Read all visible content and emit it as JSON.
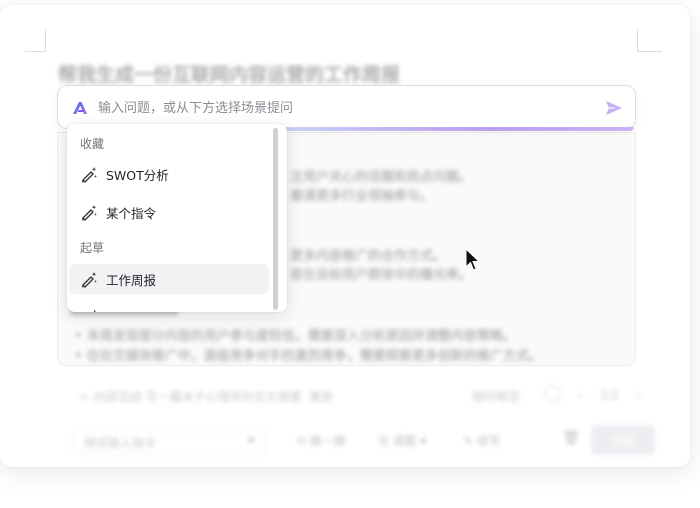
{
  "background_doc": {
    "title": "帮我生成一份互联网内容运营的工作周报",
    "lines": [
      "注用户关心的话题和热点问题。",
      "邀请更多行业领袖参与。",
      "更多内容推广的合作方式。",
      "容在目标用户群体中的曝光率。",
      "本周发现部分内容的用户参与度较低，需要深入分析原因并调整内容策略。",
      "在社交媒体推广中，面临竞争对手的激烈竞争，需要探索更多创新的推广方式。"
    ],
    "prompt_hint": "内容总结 写一篇关于心理学的论文摘要",
    "hint_action": "重新",
    "footer_meta": "随时帮您",
    "pager": "1/2",
    "footer_input_placeholder": "继续输入指令",
    "actions": [
      "换一换",
      "调整",
      "续写"
    ],
    "primary_label": "保留"
  },
  "ai_bar": {
    "placeholder": "输入问题，或从下方选择场景提问",
    "logo_icon": "ai-brand-logo",
    "send_icon": "send-arrow-icon",
    "accent_color": "#b59cf2"
  },
  "dropdown": {
    "groups": [
      {
        "label": "收藏",
        "items": [
          {
            "label": "SWOT分析",
            "icon": "magic-pen-icon"
          },
          {
            "label": "某个指令",
            "icon": "magic-pen-icon"
          }
        ]
      },
      {
        "label": "起草",
        "items": [
          {
            "label": "工作周报",
            "icon": "magic-pen-icon",
            "selected": true
          }
        ]
      }
    ]
  }
}
